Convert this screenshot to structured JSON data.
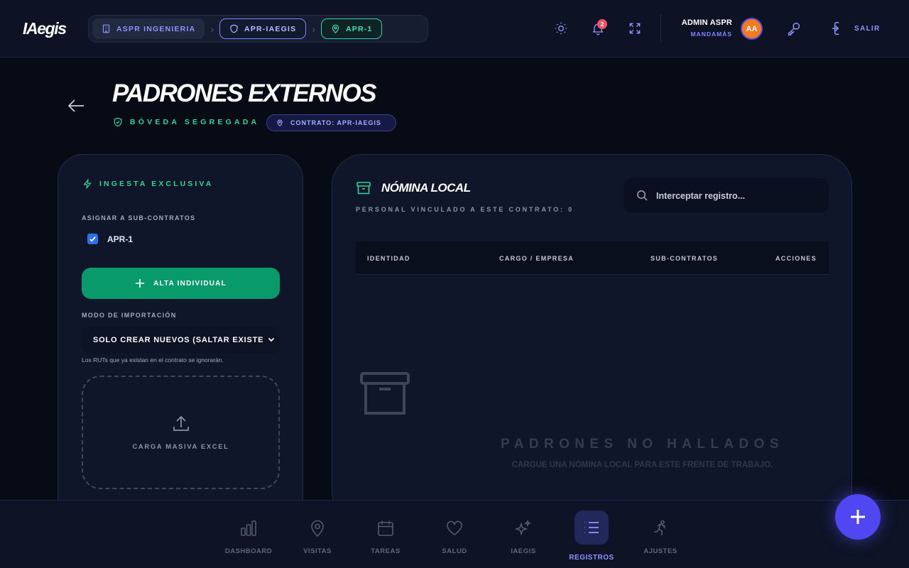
{
  "app": {
    "logo": "IAegis"
  },
  "breadcrumb": [
    {
      "label": "ASPR INGENIERIA",
      "icon": "building-icon"
    },
    {
      "label": "APR-IAEGIS",
      "icon": "shield-icon"
    },
    {
      "label": "APR-1",
      "icon": "map-pin-icon"
    }
  ],
  "header": {
    "notifications_count": "2",
    "user_name": "ADMIN ASPR",
    "user_role": "MANDAMÁS",
    "avatar_initials": "AA",
    "logout_label": "SALIR",
    "icons": [
      "sun-icon",
      "bell-icon",
      "expand-icon",
      "key-icon",
      "logout-icon"
    ]
  },
  "page": {
    "title": "PADRONES EXTERNOS",
    "vault_label": "BÓVEDA SEGREGADA",
    "contract_chip": "CONTRATO: APR-IAEGIS"
  },
  "ingest": {
    "title": "INGESTA EXCLUSIVA",
    "assign_label": "ASIGNAR A SUB-CONTRATOS",
    "subcontracts": [
      {
        "label": "APR-1",
        "checked": true
      }
    ],
    "add_button": "ALTA INDIVIDUAL",
    "import_mode_label": "MODO DE IMPORTACIÓN",
    "import_mode_value": "SOLO CREAR NUEVOS (SALTAR EXISTE",
    "import_hint": "Los RUTs que ya existan en el contrato se ignorarán.",
    "bulk_upload_label": "CARGA MASIVA EXCEL"
  },
  "roster": {
    "title": "NÓMINA LOCAL",
    "subtitle": "PERSONAL VINCULADO A ESTE CONTRATO: 0",
    "search_placeholder": "Interceptar registro...",
    "columns": [
      "IDENTIDAD",
      "CARGO / EMPRESA",
      "SUB-CONTRATOS",
      "ACCIONES"
    ],
    "rows": [],
    "empty_title": "PADRONES NO HALLADOS",
    "empty_subtitle": "CARGUE UNA NÓMINA LOCAL PARA ESTE FRENTE DE TRABAJO."
  },
  "nav": [
    {
      "label": "DASHBOARD",
      "icon": "bar-chart-icon",
      "active": false
    },
    {
      "label": "VISITAS",
      "icon": "map-pin-icon",
      "active": false
    },
    {
      "label": "TAREAS",
      "icon": "calendar-icon",
      "active": false
    },
    {
      "label": "SALUD",
      "icon": "heart-icon",
      "active": false
    },
    {
      "label": "IAEGIS",
      "icon": "sparkles-icon",
      "active": false
    },
    {
      "label": "REGISTROS",
      "icon": "list-icon",
      "active": true
    },
    {
      "label": "AJUSTES",
      "icon": "running-figure-icon",
      "active": false
    }
  ],
  "colors": {
    "accent": "#5046f2",
    "success": "#089a6a",
    "teal": "#2fd59d",
    "avatar": "#f57a1f",
    "badge": "#f05266"
  }
}
